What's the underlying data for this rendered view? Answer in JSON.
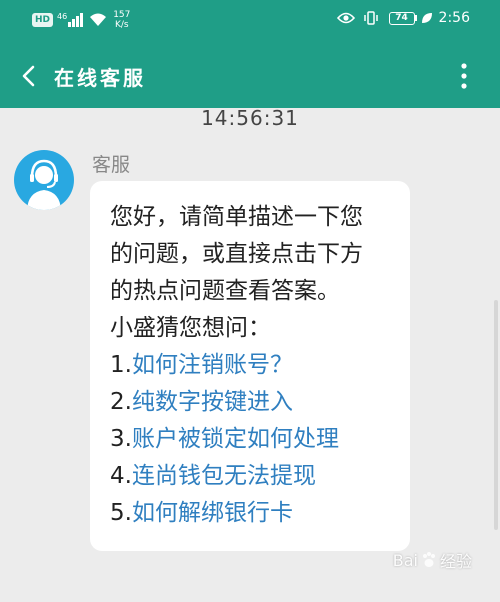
{
  "status_bar": {
    "hd": "HD",
    "signal_type": "46",
    "speed_value": "157",
    "speed_unit": "K/s",
    "battery": "74",
    "time": "2:56"
  },
  "header": {
    "title": "在线客服",
    "back_icon": "chevron-left-icon",
    "more_icon": "more-vertical-icon"
  },
  "chat": {
    "timestamp": "14:56:31",
    "sender": "客服",
    "message_lines": [
      "您好，请简单描述一下您",
      "的问题，或直接点击下方",
      "的热点问题查看答案。",
      "小盛猜您想问："
    ],
    "questions": [
      {
        "num": "1.",
        "text": "如何注销账号？"
      },
      {
        "num": "2.",
        "text": "纯数字按键进入"
      },
      {
        "num": "3.",
        "text": "账户被锁定如何处理"
      },
      {
        "num": "4.",
        "text": "连尚钱包无法提现"
      },
      {
        "num": "5.",
        "text": "如何解绑银行卡"
      }
    ]
  },
  "watermark": {
    "prefix": "Bai",
    "suffix": "经验"
  },
  "colors": {
    "header": "#1f9e87",
    "background": "#ececec",
    "link": "#2f7fc0",
    "avatar": "#29a8e1"
  }
}
